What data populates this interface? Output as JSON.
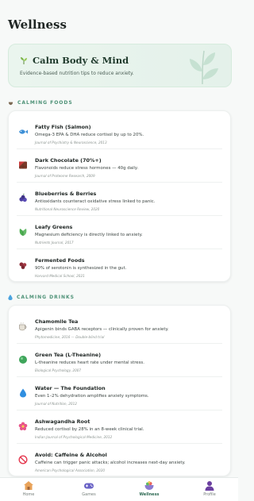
{
  "page": {
    "title": "Wellness"
  },
  "hero": {
    "title": "Calm Body & Mind",
    "subtitle": "Evidence-based nutrition tips to reduce anxiety."
  },
  "sections": {
    "foods": {
      "heading": "CALMING FOODS",
      "items": [
        {
          "name": "Fatty Fish (Salmon)",
          "desc": "Omega-3 EPA & DHA reduce cortisol by up to 20%.",
          "src": "Journal of Psychiatry & Neuroscience, 2013",
          "icon": "fish-icon"
        },
        {
          "name": "Dark Chocolate (70%+)",
          "desc": "Flavonoids reduce stress hormones — 40g daily.",
          "src": "Journal of Proteome Research, 2009",
          "icon": "chocolate-icon"
        },
        {
          "name": "Blueberries & Berries",
          "desc": "Antioxidants counteract oxidative stress linked to panic.",
          "src": "Nutritional Neuroscience Review, 2020",
          "icon": "berries-icon"
        },
        {
          "name": "Leafy Greens",
          "desc": "Magnesium deficiency is directly linked to anxiety.",
          "src": "Nutrients Journal, 2017",
          "icon": "leafy-greens-icon"
        },
        {
          "name": "Fermented Foods",
          "desc": "90% of serotonin is synthesized in the gut.",
          "src": "Harvard Medical School, 2021",
          "icon": "fermented-food-icon"
        }
      ]
    },
    "drinks": {
      "heading": "CALMING DRINKS",
      "items": [
        {
          "name": "Chamomile Tea",
          "desc": "Apigenin binds GABA receptors — clinically proven for anxiety.",
          "src": "Phytomedicine, 2016 — Double-blind trial",
          "icon": "tea-icon"
        },
        {
          "name": "Green Tea (L-Theanine)",
          "desc": "L-theanine reduces heart rate under mental stress.",
          "src": "Biological Psychology, 2007",
          "icon": "green-tea-icon"
        },
        {
          "name": "Water — The Foundation",
          "desc": "Even 1–2% dehydration amplifies anxiety symptoms.",
          "src": "Journal of Nutrition, 2012",
          "icon": "water-drop-icon"
        },
        {
          "name": "Ashwagandha Root",
          "desc": "Reduced cortisol by 28% in an 8-week clinical trial.",
          "src": "Indian Journal of Psychological Medicine, 2012",
          "icon": "flower-icon"
        },
        {
          "name": "Avoid: Caffeine & Alcohol",
          "desc": "Caffeine can trigger panic attacks; alcohol increases next-day anxiety.",
          "src": "American Psychological Association, 2020",
          "icon": "prohibited-icon"
        }
      ]
    }
  },
  "tabbar": {
    "tabs": [
      {
        "label": "Home",
        "icon": "home-icon",
        "active": false
      },
      {
        "label": "Games",
        "icon": "gamepad-icon",
        "active": false
      },
      {
        "label": "Wellness",
        "icon": "wellness-icon",
        "active": true
      },
      {
        "label": "Profile",
        "icon": "profile-icon",
        "active": false
      }
    ]
  },
  "colors": {
    "accent": "#4e9277",
    "active_tab": "#2f6b54",
    "hero_bg": "#e8f4ed"
  }
}
